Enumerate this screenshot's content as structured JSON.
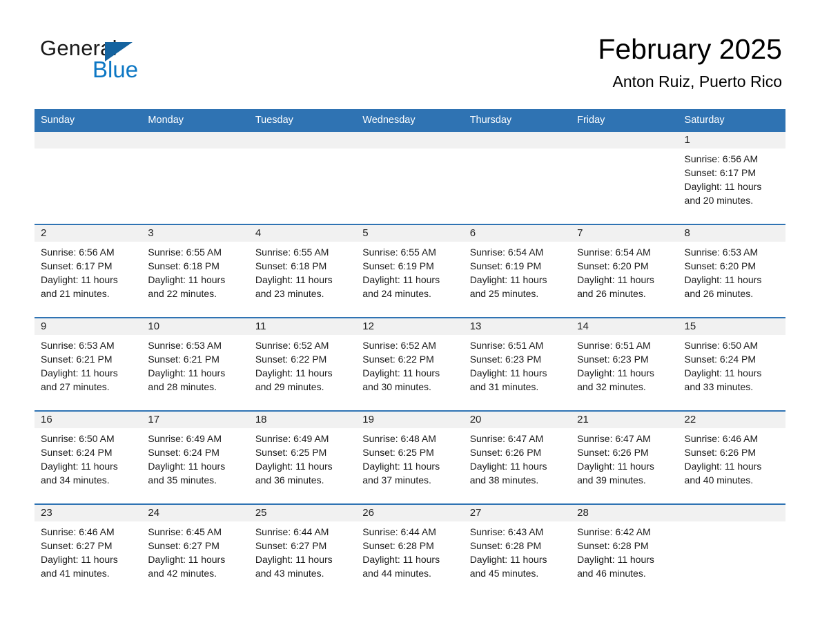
{
  "logo": {
    "word_one": "General",
    "word_two": "Blue",
    "triangle_icon": "triangle-icon",
    "accent_dark": "#15639f",
    "accent_blue": "#0c77c4"
  },
  "header": {
    "month_title": "February 2025",
    "location": "Anton Ruiz, Puerto Rico"
  },
  "colors": {
    "header_blue": "#2f73b3",
    "daynum_band": "#f1f1f1",
    "cell_background": "#ffffff",
    "text": "#1a1a1a"
  },
  "weekday_headers": [
    "Sunday",
    "Monday",
    "Tuesday",
    "Wednesday",
    "Thursday",
    "Friday",
    "Saturday"
  ],
  "weeks": [
    [
      {
        "day": "",
        "blank": true
      },
      {
        "day": "",
        "blank": true
      },
      {
        "day": "",
        "blank": true
      },
      {
        "day": "",
        "blank": true
      },
      {
        "day": "",
        "blank": true
      },
      {
        "day": "",
        "blank": true
      },
      {
        "day": "1",
        "sunrise": "Sunrise: 6:56 AM",
        "sunset": "Sunset: 6:17 PM",
        "daylight": "Daylight: 11 hours and 20 minutes."
      }
    ],
    [
      {
        "day": "2",
        "sunrise": "Sunrise: 6:56 AM",
        "sunset": "Sunset: 6:17 PM",
        "daylight": "Daylight: 11 hours and 21 minutes."
      },
      {
        "day": "3",
        "sunrise": "Sunrise: 6:55 AM",
        "sunset": "Sunset: 6:18 PM",
        "daylight": "Daylight: 11 hours and 22 minutes."
      },
      {
        "day": "4",
        "sunrise": "Sunrise: 6:55 AM",
        "sunset": "Sunset: 6:18 PM",
        "daylight": "Daylight: 11 hours and 23 minutes."
      },
      {
        "day": "5",
        "sunrise": "Sunrise: 6:55 AM",
        "sunset": "Sunset: 6:19 PM",
        "daylight": "Daylight: 11 hours and 24 minutes."
      },
      {
        "day": "6",
        "sunrise": "Sunrise: 6:54 AM",
        "sunset": "Sunset: 6:19 PM",
        "daylight": "Daylight: 11 hours and 25 minutes."
      },
      {
        "day": "7",
        "sunrise": "Sunrise: 6:54 AM",
        "sunset": "Sunset: 6:20 PM",
        "daylight": "Daylight: 11 hours and 26 minutes."
      },
      {
        "day": "8",
        "sunrise": "Sunrise: 6:53 AM",
        "sunset": "Sunset: 6:20 PM",
        "daylight": "Daylight: 11 hours and 26 minutes."
      }
    ],
    [
      {
        "day": "9",
        "sunrise": "Sunrise: 6:53 AM",
        "sunset": "Sunset: 6:21 PM",
        "daylight": "Daylight: 11 hours and 27 minutes."
      },
      {
        "day": "10",
        "sunrise": "Sunrise: 6:53 AM",
        "sunset": "Sunset: 6:21 PM",
        "daylight": "Daylight: 11 hours and 28 minutes."
      },
      {
        "day": "11",
        "sunrise": "Sunrise: 6:52 AM",
        "sunset": "Sunset: 6:22 PM",
        "daylight": "Daylight: 11 hours and 29 minutes."
      },
      {
        "day": "12",
        "sunrise": "Sunrise: 6:52 AM",
        "sunset": "Sunset: 6:22 PM",
        "daylight": "Daylight: 11 hours and 30 minutes."
      },
      {
        "day": "13",
        "sunrise": "Sunrise: 6:51 AM",
        "sunset": "Sunset: 6:23 PM",
        "daylight": "Daylight: 11 hours and 31 minutes."
      },
      {
        "day": "14",
        "sunrise": "Sunrise: 6:51 AM",
        "sunset": "Sunset: 6:23 PM",
        "daylight": "Daylight: 11 hours and 32 minutes."
      },
      {
        "day": "15",
        "sunrise": "Sunrise: 6:50 AM",
        "sunset": "Sunset: 6:24 PM",
        "daylight": "Daylight: 11 hours and 33 minutes."
      }
    ],
    [
      {
        "day": "16",
        "sunrise": "Sunrise: 6:50 AM",
        "sunset": "Sunset: 6:24 PM",
        "daylight": "Daylight: 11 hours and 34 minutes."
      },
      {
        "day": "17",
        "sunrise": "Sunrise: 6:49 AM",
        "sunset": "Sunset: 6:24 PM",
        "daylight": "Daylight: 11 hours and 35 minutes."
      },
      {
        "day": "18",
        "sunrise": "Sunrise: 6:49 AM",
        "sunset": "Sunset: 6:25 PM",
        "daylight": "Daylight: 11 hours and 36 minutes."
      },
      {
        "day": "19",
        "sunrise": "Sunrise: 6:48 AM",
        "sunset": "Sunset: 6:25 PM",
        "daylight": "Daylight: 11 hours and 37 minutes."
      },
      {
        "day": "20",
        "sunrise": "Sunrise: 6:47 AM",
        "sunset": "Sunset: 6:26 PM",
        "daylight": "Daylight: 11 hours and 38 minutes."
      },
      {
        "day": "21",
        "sunrise": "Sunrise: 6:47 AM",
        "sunset": "Sunset: 6:26 PM",
        "daylight": "Daylight: 11 hours and 39 minutes."
      },
      {
        "day": "22",
        "sunrise": "Sunrise: 6:46 AM",
        "sunset": "Sunset: 6:26 PM",
        "daylight": "Daylight: 11 hours and 40 minutes."
      }
    ],
    [
      {
        "day": "23",
        "sunrise": "Sunrise: 6:46 AM",
        "sunset": "Sunset: 6:27 PM",
        "daylight": "Daylight: 11 hours and 41 minutes."
      },
      {
        "day": "24",
        "sunrise": "Sunrise: 6:45 AM",
        "sunset": "Sunset: 6:27 PM",
        "daylight": "Daylight: 11 hours and 42 minutes."
      },
      {
        "day": "25",
        "sunrise": "Sunrise: 6:44 AM",
        "sunset": "Sunset: 6:27 PM",
        "daylight": "Daylight: 11 hours and 43 minutes."
      },
      {
        "day": "26",
        "sunrise": "Sunrise: 6:44 AM",
        "sunset": "Sunset: 6:28 PM",
        "daylight": "Daylight: 11 hours and 44 minutes."
      },
      {
        "day": "27",
        "sunrise": "Sunrise: 6:43 AM",
        "sunset": "Sunset: 6:28 PM",
        "daylight": "Daylight: 11 hours and 45 minutes."
      },
      {
        "day": "28",
        "sunrise": "Sunrise: 6:42 AM",
        "sunset": "Sunset: 6:28 PM",
        "daylight": "Daylight: 11 hours and 46 minutes."
      },
      {
        "day": "",
        "blank": true,
        "trailing": true
      }
    ]
  ]
}
